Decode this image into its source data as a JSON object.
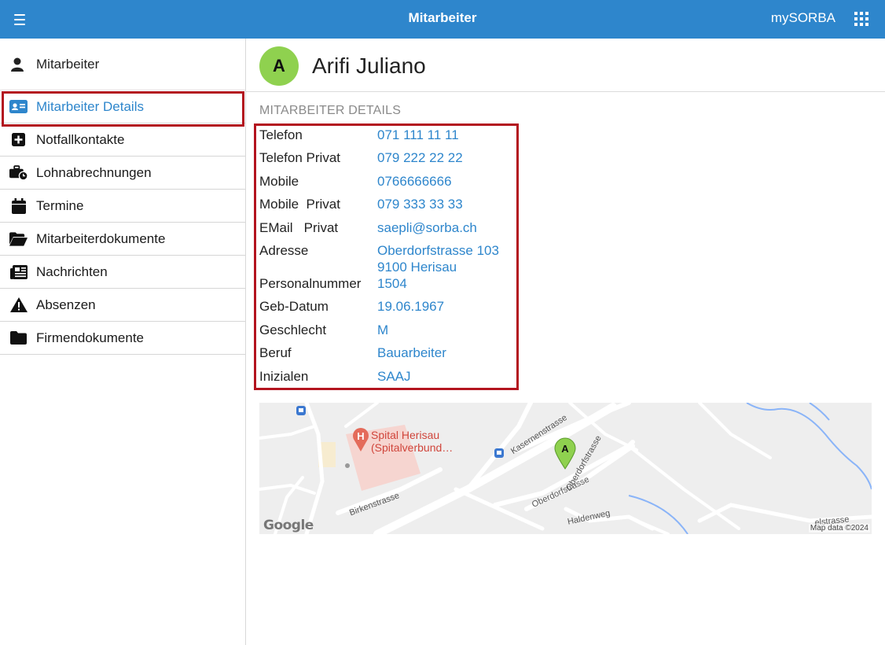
{
  "header": {
    "title": "Mitarbeiter",
    "brand": "mySORBA"
  },
  "sidebar": {
    "head_label": "Mitarbeiter",
    "items": [
      {
        "label": "Mitarbeiter Details",
        "icon": "id-card-icon",
        "active": true
      },
      {
        "label": "Notfallkontakte",
        "icon": "plus-square-icon"
      },
      {
        "label": "Lohnabrechnungen",
        "icon": "briefcase-clock-icon"
      },
      {
        "label": "Termine",
        "icon": "calendar-icon"
      },
      {
        "label": "Mitarbeiterdokumente",
        "icon": "folder-open-icon"
      },
      {
        "label": "Nachrichten",
        "icon": "newspaper-icon"
      },
      {
        "label": "Absenzen",
        "icon": "warning-icon"
      },
      {
        "label": "Firmendokumente",
        "icon": "folder-icon"
      }
    ]
  },
  "person": {
    "initial": "A",
    "name": "Arifi Juliano"
  },
  "details": {
    "section_title": "MITARBEITER DETAILS",
    "rows": [
      {
        "key": "Telefon",
        "value": "071 111 11 11"
      },
      {
        "key": "Telefon Privat",
        "value": "079 222 22 22"
      },
      {
        "key": "Mobile",
        "value": "0766666666"
      },
      {
        "key": "Mobile  Privat",
        "value": "079 333 33 33"
      },
      {
        "key": "EMail   Privat",
        "value": "saepli@sorba.ch"
      },
      {
        "key": "Adresse",
        "value": "Oberdorfstrasse 103",
        "value2": "9100 Herisau"
      },
      {
        "key": "Personalnummer",
        "value": "1504"
      },
      {
        "key": "Geb-Datum",
        "value": "19.06.1967"
      },
      {
        "key": "Geschlecht",
        "value": "M"
      },
      {
        "key": "Beruf",
        "value": "Bauarbeiter"
      },
      {
        "key": "Inizialen",
        "value": "SAAJ"
      }
    ]
  },
  "map": {
    "poi_line1": "Spital Herisau",
    "poi_line2": "(Spitalverbund…",
    "marker_label": "A",
    "streets": {
      "kasernen": "Kasernenstrasse",
      "oberdorf1": "Oberdorfstrasse",
      "oberdorf2": "Oberdorfstrasse",
      "birken": "Birkenstrasse",
      "halden": "Haldenweg",
      "edge": "elstrasse"
    },
    "logo": "Google",
    "attribution": "Map data ©2024"
  },
  "colors": {
    "header_bg": "#2e86cc",
    "link": "#2e86cc",
    "highlight": "#b3141f",
    "avatar": "#8fd14f"
  }
}
